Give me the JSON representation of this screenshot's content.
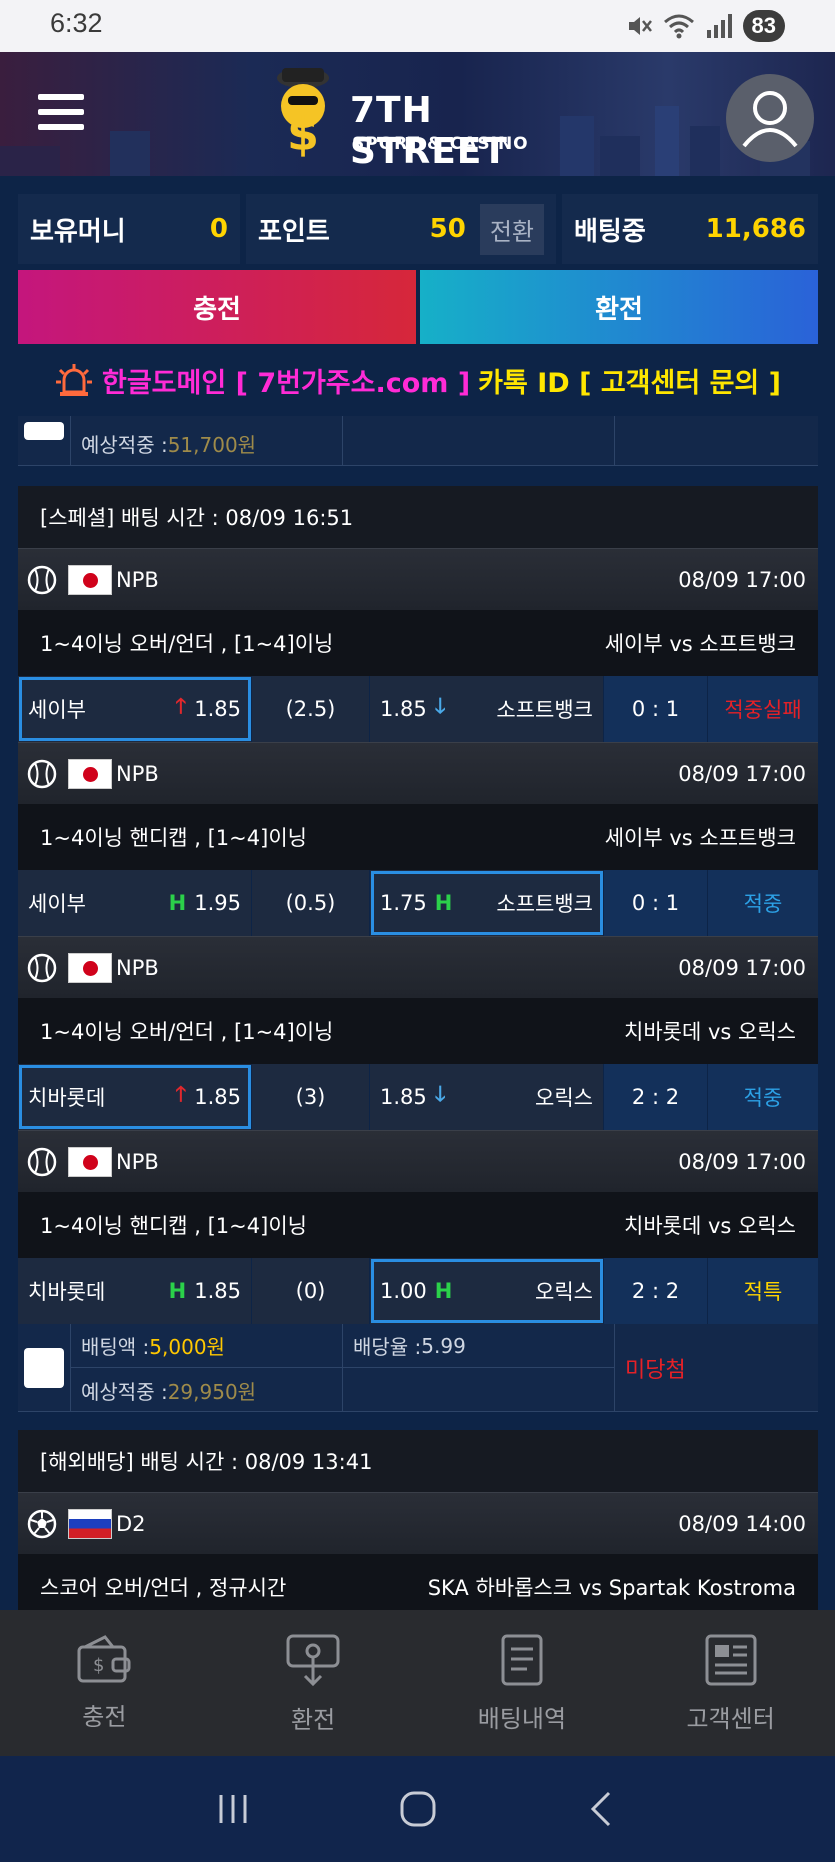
{
  "status_bar": {
    "time": "6:32",
    "battery": "83"
  },
  "header": {
    "brand_title": "7TH STREET",
    "brand_subtitle": "SPORT & CASINO"
  },
  "balance": {
    "money_label": "보유머니",
    "money_value": "0",
    "point_label": "포인트",
    "point_value": "50",
    "convert_label": "전환",
    "betting_label": "배팅중",
    "betting_value": "11,686"
  },
  "actions": {
    "charge": "충전",
    "exchange": "환전"
  },
  "notice": {
    "part1": "한글도메인 [ 7번가주소.com ]",
    "part2": "카톡 ID [ 고객센터 문의 ]"
  },
  "top_partial": {
    "expected_label": "예상적중 : ",
    "expected_value": "51,700원"
  },
  "section1": {
    "title": "[스페셜] 배팅 시간 : 08/09 16:51",
    "games": [
      {
        "league": "NPB",
        "datetime": "08/09 17:00",
        "market": "1~4이닝 오버/언더 , [1~4]이닝",
        "teams": "세이부  vs  소프트뱅크",
        "home": "세이부",
        "home_odds": "1.85",
        "line": "(2.5)",
        "away_odds": "1.85",
        "away": "소프트뱅크",
        "score": "0 : 1",
        "result": "적중실패"
      },
      {
        "league": "NPB",
        "datetime": "08/09 17:00",
        "market": "1~4이닝 핸디캡 , [1~4]이닝",
        "teams": "세이부  vs  소프트뱅크",
        "home": "세이부",
        "home_odds": "1.95",
        "line": "(0.5)",
        "away_odds": "1.75",
        "away": "소프트뱅크",
        "score": "0 : 1",
        "result": "적중"
      },
      {
        "league": "NPB",
        "datetime": "08/09 17:00",
        "market": "1~4이닝 오버/언더 , [1~4]이닝",
        "teams": "치바롯데  vs  오릭스",
        "home": "치바롯데",
        "home_odds": "1.85",
        "line": "(3)",
        "away_odds": "1.85",
        "away": "오릭스",
        "score": "2 : 2",
        "result": "적중"
      },
      {
        "league": "NPB",
        "datetime": "08/09 17:00",
        "market": "1~4이닝 핸디캡 , [1~4]이닝",
        "teams": "치바롯데  vs  오릭스",
        "home": "치바롯데",
        "home_odds": "1.85",
        "line": "(0)",
        "away_odds": "1.00",
        "away": "오릭스",
        "score": "2 : 2",
        "result": "적특"
      }
    ],
    "footer": {
      "bet_label": "배팅액 : ",
      "bet_value": "5,000원",
      "rate_label": "배당율 : ",
      "rate_value": "5.99",
      "expected_label": "예상적중 : ",
      "expected_value": "29,950원",
      "status": "미당첨"
    }
  },
  "section2": {
    "title": "[해외배당] 배팅 시간 : 08/09 13:41",
    "league": "D2",
    "datetime": "08/09 14:00",
    "market": "스코어 오버/언더 , 정규시간",
    "teams": "SKA 하바롭스크  vs  Spartak Kostroma"
  },
  "bottom_nav": [
    "충전",
    "환전",
    "배팅내역",
    "고객센터"
  ],
  "colors": {
    "accent_yellow": "#ffd400",
    "fail_red": "#e52127",
    "hit_blue": "#2ca1e6",
    "selected_border": "#2a8ee2"
  }
}
